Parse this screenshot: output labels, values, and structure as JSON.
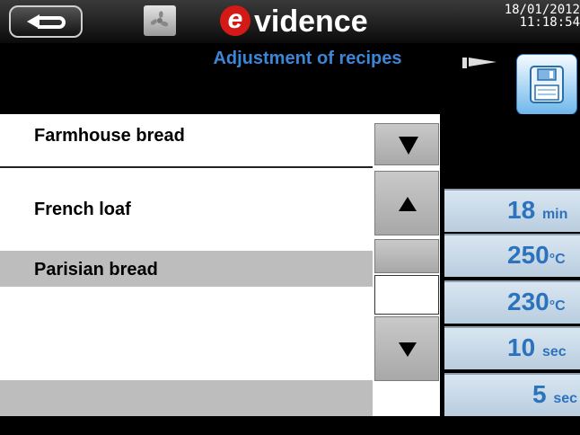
{
  "header": {
    "logo_e": "e",
    "logo_text": "vidence",
    "date": "18/01/2012",
    "time": "11:18:54"
  },
  "title": "Adjustment of recipes",
  "recipes": [
    {
      "label": "Farmhouse bread",
      "selected": false
    },
    {
      "label": "French loaf",
      "selected": false
    },
    {
      "label": "Parisian bread",
      "selected": true
    }
  ],
  "parameters": [
    {
      "value": "18",
      "unit": "min"
    },
    {
      "value": "250",
      "unit": "°C"
    },
    {
      "value": "230",
      "unit": "°C"
    },
    {
      "value": "10",
      "unit": "sec"
    },
    {
      "value": "5",
      "unit": "sec"
    }
  ],
  "colors": {
    "title": "#3b86d6",
    "selected_row": "#bdbdbd",
    "param_text": "#2c73bd",
    "logo_red": "#d31a16"
  },
  "icons": [
    "back-arrow-icon",
    "fan-icon",
    "arrow-right-icon",
    "save-icon",
    "triangle-down-icon",
    "triangle-up-icon"
  ]
}
